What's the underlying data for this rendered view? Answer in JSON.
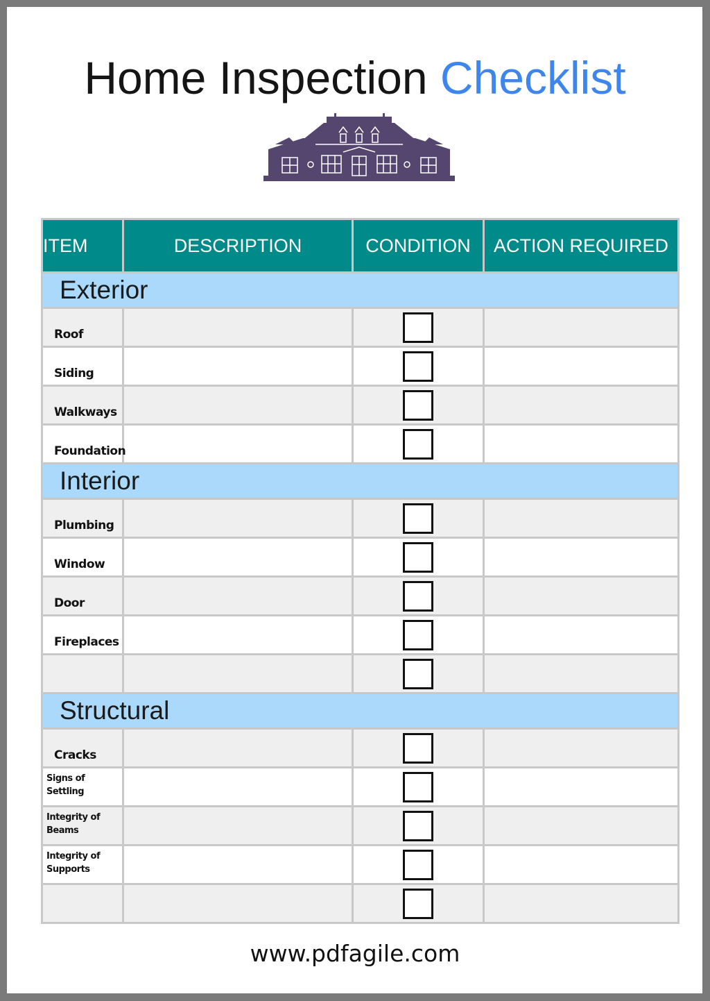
{
  "title": {
    "main": "Home Inspection",
    "accent": "Checklist"
  },
  "logo": {
    "icon": "house-icon",
    "color": "#54466f"
  },
  "columns": [
    "ITEM",
    "DESCRIPTION",
    "CONDITION",
    "ACTION REQUIRED"
  ],
  "sections": [
    {
      "name": "Exterior",
      "items": [
        "Roof",
        "Siding",
        "Walkways",
        "Foundation"
      ]
    },
    {
      "name": "Interior",
      "items": [
        "Plumbing",
        "Window",
        "Door",
        "Fireplaces",
        ""
      ]
    },
    {
      "name": "Structural",
      "items": [
        "Cracks",
        "Signs of Settling",
        "Integrity of Beams",
        "Integrity of Supports",
        ""
      ]
    }
  ],
  "colors": {
    "header_bg": "#008a89",
    "section_bg": "#aad9fb",
    "accent_title": "#3f86ec",
    "alt_row": "#efefef"
  },
  "footer": "www.pdfagile.com"
}
